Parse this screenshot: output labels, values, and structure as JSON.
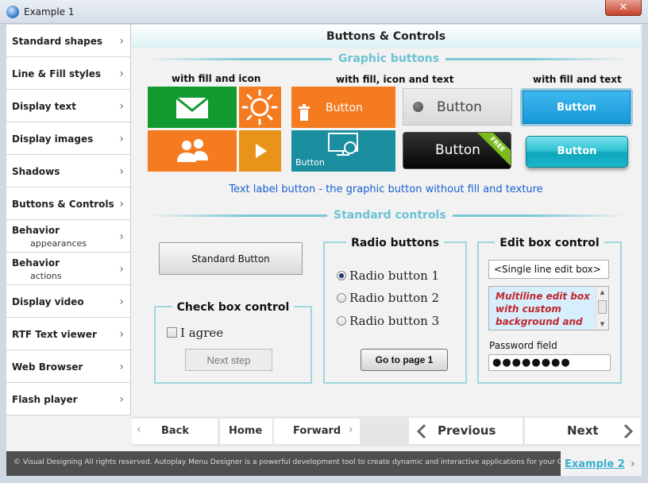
{
  "window": {
    "title": "Example 1",
    "close_glyph": "✕"
  },
  "sidebar": {
    "items": [
      {
        "label": "Standard shapes"
      },
      {
        "label": "Line & Fill styles"
      },
      {
        "label": "Display text"
      },
      {
        "label": "Display images"
      },
      {
        "label": "Shadows"
      },
      {
        "label": "Buttons & Controls"
      },
      {
        "label": "Behavior",
        "sub": "appearances"
      },
      {
        "label": "Behavior",
        "sub": "actions"
      },
      {
        "label": "Display video"
      },
      {
        "label": "RTF Text viewer"
      },
      {
        "label": "Web Browser"
      },
      {
        "label": "Flash player"
      }
    ],
    "chevron": "›"
  },
  "page": {
    "title": "Buttons & Controls"
  },
  "graphic": {
    "section_label": "Graphic buttons",
    "col1_caption": "with fill and icon",
    "col2_caption": "with fill, icon and text",
    "col3_caption": "with fill and text",
    "orange_button": "Button",
    "teal_button": "Button",
    "gray_button": "Button",
    "black_button": "Button",
    "ribbon_text": "FREE",
    "blue_button": "Button",
    "teal_gloss_button": "Button",
    "text_label_button": "Text label button - the graphic button without fill and texture"
  },
  "standard": {
    "section_label": "Standard controls",
    "standard_button": "Standard Button",
    "checkbox_group_title": "Check box control",
    "checkbox_label": "I agree",
    "next_step": "Next step",
    "radio_group_title": "Radio buttons",
    "radios": [
      {
        "label": "Radio button 1",
        "checked": true
      },
      {
        "label": "Radio button 2",
        "checked": false
      },
      {
        "label": "Radio button 3",
        "checked": false
      }
    ],
    "goto_button": "Go to page 1",
    "edit_group_title": "Edit box control",
    "single_line_value": "<Single line edit box>",
    "multiline_value": "Multiline edit box with custom background and",
    "password_label": "Password field",
    "password_value": "●●●●●●●●"
  },
  "nav": {
    "back": "Back",
    "home": "Home",
    "forward": "Forward",
    "previous": "Previous",
    "next": "Next"
  },
  "footer": {
    "text": "© Visual Designing All rights reserved. Autoplay Menu Designer is a powerful development tool to create dynamic and interactive applications for your CD or DVDs",
    "example2": "Example 2"
  },
  "colors": {
    "accent": "#6cc3d3",
    "green": "#119a2f",
    "orange": "#f47b20",
    "teal": "#1b8fa0",
    "link": "#1a5fd0"
  }
}
